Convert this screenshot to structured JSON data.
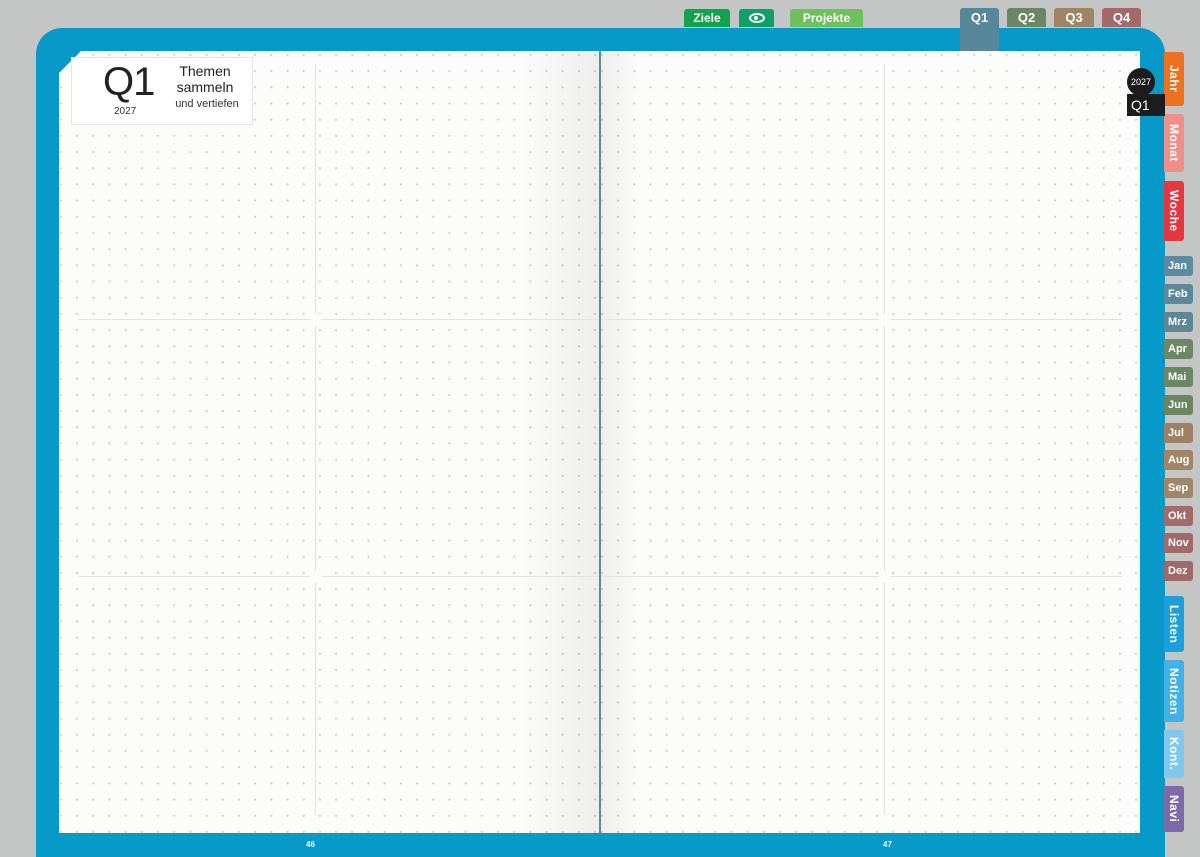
{
  "header": {
    "quarter": "Q1",
    "year": "2027",
    "title_line1": "Themen",
    "title_line2": "sammeln",
    "subtitle": "und vertiefen"
  },
  "top_tabs": {
    "goals": "Ziele",
    "view_icon": "eye-icon",
    "projects": "Projekte"
  },
  "quarter_tabs": [
    "Q1",
    "Q2",
    "Q3",
    "Q4"
  ],
  "side_tabs": {
    "year": "Jahr",
    "month": "Monat",
    "week": "Woche",
    "lists": "Listen",
    "notes": "Notizen",
    "contacts": "Kont.",
    "navigation": "Navi"
  },
  "months": [
    "Jan",
    "Feb",
    "Mrz",
    "Apr",
    "Mai",
    "Jun",
    "Jul",
    "Aug",
    "Sep",
    "Okt",
    "Nov",
    "Dez"
  ],
  "current": {
    "year": "2027",
    "quarter": "Q1"
  },
  "page_numbers": {
    "left": "46",
    "right": "47"
  },
  "colors": {
    "cover": "#0799c8",
    "ziele": "#13a34f",
    "projekte": "#6dc05b",
    "q1": "#56889a",
    "q2": "#6b8662",
    "q3": "#a08466",
    "q4": "#a26b6a",
    "jahr": "#ee7120",
    "monat": "#ef8f8a",
    "woche": "#e5373f",
    "listen": "#1d9fd8",
    "notizen": "#42b2e6",
    "kont": "#80c8ec",
    "navi": "#7c6aa9"
  }
}
